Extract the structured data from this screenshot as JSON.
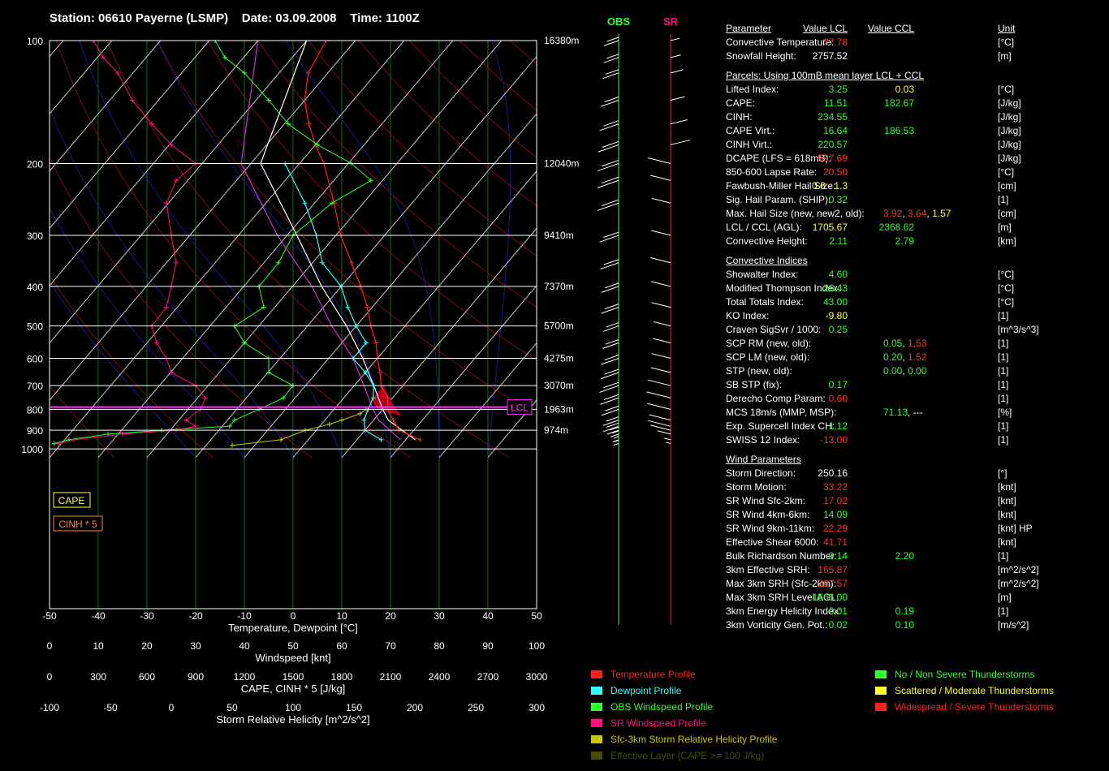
{
  "header": {
    "station": "Station: 06610 Payerne (LSMP)",
    "date": "Date: 03.09.2008",
    "time": "Time: 1100Z"
  },
  "chart_data": {
    "type": "line",
    "pressure_ticks": [
      "100",
      "200",
      "300",
      "400",
      "500",
      "600",
      "700",
      "800",
      "900",
      "1000"
    ],
    "height_ticks": [
      {
        "p": 100,
        "label": "16380m"
      },
      {
        "p": 200,
        "label": "12040m"
      },
      {
        "p": 300,
        "label": "9410m"
      },
      {
        "p": 400,
        "label": "7370m"
      },
      {
        "p": 500,
        "label": "5700m"
      },
      {
        "p": 600,
        "label": "4275m"
      },
      {
        "p": 700,
        "label": "3070m"
      },
      {
        "p": 800,
        "label": "1963m"
      },
      {
        "p": 900,
        "label": "974m"
      }
    ],
    "axes": [
      {
        "label": "Temperature, Dewpoint [°C]",
        "ticks": [
          "-50",
          "-40",
          "-30",
          "-20",
          "-10",
          "0",
          "10",
          "20",
          "30",
          "40",
          "50"
        ]
      },
      {
        "label": "Windspeed [knt]",
        "ticks": [
          "0",
          "10",
          "20",
          "30",
          "40",
          "50",
          "60",
          "70",
          "80",
          "90",
          "100"
        ]
      },
      {
        "label": "CAPE, CINH * 5 [J/kg]",
        "ticks": [
          "0",
          "300",
          "600",
          "900",
          "1200",
          "1500",
          "1800",
          "2100",
          "2400",
          "2700",
          "3000"
        ]
      },
      {
        "label": "Storm Relative Helicity [m^2/s^2]",
        "ticks": [
          "-100",
          "-50",
          "0",
          "50",
          "100",
          "150",
          "200",
          "250",
          "300"
        ]
      }
    ],
    "boxes": {
      "cape": "CAPE",
      "cinh": "CINH * 5",
      "lcl": "LCL"
    },
    "wind_columns": {
      "obs": "OBS",
      "sr": "SR"
    },
    "temperature": [
      [
        950,
        23
      ],
      [
        900,
        17
      ],
      [
        850,
        14
      ],
      [
        800,
        11
      ],
      [
        750,
        9
      ],
      [
        700,
        5.5
      ],
      [
        650,
        3
      ],
      [
        600,
        0
      ],
      [
        550,
        -3
      ],
      [
        500,
        -7
      ],
      [
        450,
        -11
      ],
      [
        400,
        -16
      ],
      [
        350,
        -22
      ],
      [
        300,
        -29
      ],
      [
        250,
        -36
      ],
      [
        200,
        -45
      ],
      [
        180,
        -50
      ],
      [
        160,
        -55
      ],
      [
        140,
        -60
      ],
      [
        120,
        -64
      ],
      [
        100,
        -66
      ]
    ],
    "dewpoint": [
      [
        950,
        15
      ],
      [
        900,
        10
      ],
      [
        850,
        8
      ],
      [
        800,
        7
      ],
      [
        750,
        6
      ],
      [
        700,
        4
      ],
      [
        650,
        0
      ],
      [
        600,
        -5
      ],
      [
        550,
        -5
      ],
      [
        500,
        -10
      ],
      [
        450,
        -15
      ],
      [
        400,
        -20
      ],
      [
        350,
        -28
      ],
      [
        300,
        -34
      ],
      [
        250,
        -42
      ],
      [
        200,
        -53
      ]
    ],
    "parcel_white": [
      [
        950,
        22
      ],
      [
        850,
        13
      ],
      [
        800,
        10
      ],
      [
        700,
        4
      ],
      [
        600,
        -3
      ],
      [
        500,
        -12
      ],
      [
        400,
        -24
      ],
      [
        300,
        -38
      ],
      [
        200,
        -58
      ],
      [
        100,
        -70
      ]
    ],
    "parcel_magenta": [
      [
        950,
        19
      ],
      [
        850,
        11
      ],
      [
        800,
        8
      ],
      [
        700,
        2
      ],
      [
        600,
        -5
      ],
      [
        500,
        -15
      ],
      [
        400,
        -26
      ],
      [
        300,
        -42
      ],
      [
        200,
        -62
      ],
      [
        100,
        -80
      ]
    ],
    "obs_windspeed": [
      [
        970,
        1
      ],
      [
        950,
        4
      ],
      [
        920,
        12
      ],
      [
        900,
        23
      ],
      [
        880,
        37
      ],
      [
        850,
        38
      ],
      [
        800,
        43
      ],
      [
        750,
        48
      ],
      [
        700,
        50
      ],
      [
        650,
        45
      ],
      [
        600,
        45
      ],
      [
        550,
        40
      ],
      [
        500,
        38
      ],
      [
        450,
        44
      ],
      [
        400,
        43
      ],
      [
        350,
        47
      ],
      [
        300,
        50
      ],
      [
        250,
        58
      ],
      [
        220,
        66
      ],
      [
        200,
        62
      ],
      [
        180,
        55
      ],
      [
        160,
        49
      ],
      [
        140,
        45
      ],
      [
        120,
        40
      ],
      [
        110,
        36
      ],
      [
        100,
        34
      ]
    ],
    "sr_windspeed": [
      [
        970,
        2
      ],
      [
        950,
        5
      ],
      [
        920,
        15
      ],
      [
        900,
        26
      ],
      [
        880,
        30
      ],
      [
        850,
        28
      ],
      [
        800,
        31
      ],
      [
        750,
        32
      ],
      [
        700,
        30
      ],
      [
        650,
        25
      ],
      [
        600,
        24
      ],
      [
        550,
        22
      ],
      [
        500,
        21
      ],
      [
        450,
        24
      ],
      [
        400,
        25
      ],
      [
        350,
        26
      ],
      [
        300,
        25
      ],
      [
        250,
        24
      ],
      [
        220,
        26
      ],
      [
        200,
        30
      ],
      [
        180,
        25
      ],
      [
        160,
        21
      ],
      [
        140,
        17
      ],
      [
        120,
        14
      ],
      [
        110,
        11
      ],
      [
        100,
        9
      ]
    ],
    "srh_profile": [
      [
        980,
        50
      ],
      [
        950,
        90
      ],
      [
        900,
        110
      ],
      [
        870,
        130
      ],
      [
        850,
        140
      ],
      [
        820,
        155
      ],
      [
        800,
        160
      ]
    ]
  },
  "parameters": {
    "headers": {
      "param": "Parameter",
      "v1": "Value LCL",
      "v2": "Value CCL",
      "unit": "Unit"
    },
    "rows": [
      {
        "l": "Convective Temperature:",
        "v1": "27.78",
        "c1": "#ff3030",
        "v2": "",
        "c2": "",
        "u": "[°C]"
      },
      {
        "l": "Snowfall Height:",
        "v1": "2757.52",
        "c1": "#ffffff",
        "v2": "",
        "c2": "",
        "u": "[m]"
      },
      {
        "section": "Parcels: Using 100mB mean layer LCL + CCL"
      },
      {
        "l": "Lifted Index:",
        "v1": "3.25",
        "c1": "#30ff30",
        "v2": "0.03",
        "c2": "#ffff40",
        "u": "[°C]"
      },
      {
        "l": "CAPE:",
        "v1": "11.51",
        "c1": "#30ff30",
        "v2": "182.67",
        "c2": "#30ff30",
        "u": "[J/kg]"
      },
      {
        "l": "CINH:",
        "v1": "234.55",
        "c1": "#30ff30",
        "v2": "",
        "c2": "",
        "u": "[J/kg]"
      },
      {
        "l": "CAPE Virt.:",
        "v1": "16.64",
        "c1": "#30ff30",
        "v2": "186.53",
        "c2": "#30ff30",
        "u": "[J/kg]"
      },
      {
        "l": "CINH Virt.:",
        "v1": "220.57",
        "c1": "#30ff30",
        "v2": "",
        "c2": "",
        "u": "[J/kg]"
      },
      {
        "l": "DCAPE (LFS = 618mB):",
        "v1": "597.69",
        "c1": "#ff3030",
        "v2": "",
        "c2": "",
        "u": "[J/kg]"
      },
      {
        "l": "850-600 Lapse Rate:",
        "v1": "20.50",
        "c1": "#ff3030",
        "v2": "",
        "c2": "",
        "u": "[°C]"
      },
      {
        "l": "Fawbush-Miller Hail Size:",
        "v1": "0.6 - 1.3",
        "c1": "#ffff40",
        "v2": "",
        "c2": "",
        "u": "[cm]"
      },
      {
        "l": "Sig. Hail Param. (SHIP):",
        "v1": "0.32",
        "c1": "#30ff30",
        "v2": "",
        "c2": "",
        "u": "[1]"
      },
      {
        "l": "Max. Hail Size (new, new2, old):",
        "multi": [
          {
            "t": "3.92",
            "c": "#ff3030"
          },
          {
            "t": ", ",
            "c": "#ffffff"
          },
          {
            "t": "3.64",
            "c": "#ff3030"
          },
          {
            "t": ", ",
            "c": "#ffffff"
          },
          {
            "t": "1.57",
            "c": "#ffff40"
          }
        ],
        "u": "[cm]"
      },
      {
        "l": "LCL / CCL (AGL):",
        "v1": "1705.67",
        "c1": "#ffff40",
        "v2": "2368.62",
        "c2": "#30ff30",
        "u": "[m]"
      },
      {
        "l": "Convective Height:",
        "v1": "2.11",
        "c1": "#30ff30",
        "v2": "2.79",
        "c2": "#30ff30",
        "u": "[km]"
      },
      {
        "section": "Convective Indices"
      },
      {
        "l": "Showalter Index:",
        "v1": "4.60",
        "c1": "#30ff30",
        "v2": "",
        "c2": "",
        "u": "[°C]"
      },
      {
        "l": "Modified Thompson Index:",
        "v1": "26.43",
        "c1": "#30ff30",
        "v2": "",
        "c2": "",
        "u": "[°C]"
      },
      {
        "l": "Total Totals Index:",
        "v1": "43.00",
        "c1": "#30ff30",
        "v2": "",
        "c2": "",
        "u": "[°C]"
      },
      {
        "l": "KO Index:",
        "v1": "-9.80",
        "c1": "#ffff40",
        "v2": "",
        "c2": "",
        "u": "[1]"
      },
      {
        "l": "Craven SigSvr / 1000:",
        "v1": "0.25",
        "c1": "#30ff30",
        "v2": "",
        "c2": "",
        "u": "[m^3/s^3]"
      },
      {
        "l": "SCP RM (new, old):",
        "multi": [
          {
            "t": "0.05",
            "c": "#30ff30"
          },
          {
            "t": ", ",
            "c": "#ffffff"
          },
          {
            "t": "1.53",
            "c": "#ff3030"
          }
        ],
        "u": "[1]"
      },
      {
        "l": "SCP LM (new, old):",
        "multi": [
          {
            "t": "0.20",
            "c": "#30ff30"
          },
          {
            "t": ", ",
            "c": "#ffffff"
          },
          {
            "t": "1.52",
            "c": "#ff3030"
          }
        ],
        "u": "[1]"
      },
      {
        "l": "STP (new, old):",
        "multi": [
          {
            "t": "0.00",
            "c": "#30ff30"
          },
          {
            "t": ", ",
            "c": "#ffffff"
          },
          {
            "t": "0.00",
            "c": "#30ff30"
          }
        ],
        "u": "[1]"
      },
      {
        "l": "SB STP (fix):",
        "v1": "0.17",
        "c1": "#30ff30",
        "v2": "",
        "c2": "",
        "u": "[1]"
      },
      {
        "l": "Derecho Comp Param:",
        "v1": "0.60",
        "c1": "#ff3030",
        "v2": "",
        "c2": "",
        "u": "[1]"
      },
      {
        "l": "MCS 18m/s (MMP, MSP):",
        "multi": [
          {
            "t": "71.13",
            "c": "#30ff30"
          },
          {
            "t": ", ---",
            "c": "#ffffff"
          }
        ],
        "u": "[%]"
      },
      {
        "l": "Exp. Supercell Index CH:",
        "v1": "1.12",
        "c1": "#30ff30",
        "v2": "",
        "c2": "",
        "u": "[1]"
      },
      {
        "l": "SWISS 12 Index:",
        "v1": "-13.00",
        "c1": "#ff3030",
        "v2": "",
        "c2": "",
        "u": "[1]"
      },
      {
        "section": "Wind Parameters"
      },
      {
        "l": "Storm Direction:",
        "v1": "250.16",
        "c1": "#ffffff",
        "v2": "",
        "c2": "",
        "u": "[°]"
      },
      {
        "l": "Storm Motion:",
        "v1": "33.22",
        "c1": "#ff3030",
        "v2": "",
        "c2": "",
        "u": "[knt]"
      },
      {
        "l": "SR Wind Sfc-2km:",
        "v1": "17.02",
        "c1": "#ff3030",
        "v2": "",
        "c2": "",
        "u": "[knt]"
      },
      {
        "l": "SR Wind 4km-6km:",
        "v1": "14.09",
        "c1": "#30ff30",
        "v2": "",
        "c2": "",
        "u": "[knt]"
      },
      {
        "l": "SR Wind 9km-11km:",
        "v1": "22.29",
        "c1": "#ff3030",
        "v2": "",
        "c2": "",
        "u": "[knt] HP"
      },
      {
        "l": "Effective Shear 6000:",
        "v1": "41.71",
        "c1": "#ff3030",
        "v2": "",
        "c2": "",
        "u": "[knt]"
      },
      {
        "l": "Bulk Richardson Number:",
        "v1": "0.14",
        "c1": "#30ff30",
        "v2": "2.20",
        "c2": "#30ff30",
        "u": "[1]"
      },
      {
        "l": "3km Effective SRH:",
        "v1": "165.87",
        "c1": "#ff3030",
        "v2": "",
        "c2": "",
        "u": "[m^2/s^2]"
      },
      {
        "l": "Max 3km SRH (Sfc-2km):",
        "v1": "267.57",
        "c1": "#ff3030",
        "v2": "",
        "c2": "",
        "u": "[m^2/s^2]"
      },
      {
        "l": "Max 3km SRH Level AGL:",
        "v1": "1566.00",
        "c1": "#30ff30",
        "v2": "",
        "c2": "",
        "u": "[m]"
      },
      {
        "l": "3km Energy Helicity Index:",
        "v1": "0.01",
        "c1": "#30ff30",
        "v2": "0.19",
        "c2": "#30ff30",
        "u": "[1]"
      },
      {
        "l": "3km Vorticity Gen. Pot.:",
        "v1": "0.02",
        "c1": "#30ff30",
        "v2": "0.10",
        "c2": "#30ff30",
        "u": "[m/s^2]"
      }
    ]
  },
  "legend_left": [
    {
      "label": "Temperature Profile",
      "color": "#ff2020"
    },
    {
      "label": "Dewpoint Profile",
      "color": "#30ffff"
    },
    {
      "label": "OBS Windspeed Profile",
      "color": "#30ff30"
    },
    {
      "label": "SR Windspeed Profile",
      "color": "#ff1080"
    },
    {
      "label": "Sfc-3km Storm Relative Helicity Profile",
      "color": "#c8c800"
    },
    {
      "label": "Effective Layer (CAPE >= 100 J/kg)",
      "color": "#4a4a00"
    }
  ],
  "legend_right": [
    {
      "label": "No / Non Severe Thunderstorms",
      "color": "#30ff30"
    },
    {
      "label": "Scattered / Moderate Thunderstorms",
      "color": "#ffff30"
    },
    {
      "label": "Widespread / Severe Thunderstorms",
      "color": "#ff2020"
    }
  ]
}
